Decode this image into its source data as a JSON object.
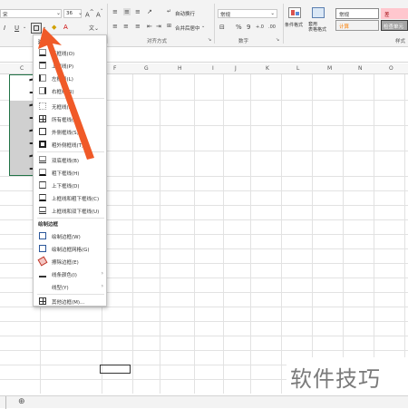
{
  "ribbon": {
    "font_size": "36",
    "font_name_fragment": "宋",
    "wrap_text_label": "自动换行",
    "merge_center_label": "合并后居中",
    "number_format": "常规",
    "align_group_label": "对齐方式",
    "number_group_label": "数字",
    "style_group_label": "样式",
    "conditional_format_label": "条件格式",
    "table_format_label": "套用\n表格格式",
    "style_normal": "常规",
    "style_bad": "差",
    "style_calc": "计算",
    "style_check": "检查单元",
    "percent_symbol": "%",
    "comma_symbol": "9",
    "increase_decimal": "+.0",
    "decrease_decimal": ".00"
  },
  "columns": [
    "C",
    "D",
    "E",
    "F",
    "G",
    "H",
    "I",
    "J",
    "K",
    "L",
    "M",
    "N",
    "O"
  ],
  "cells": [
    "1",
    "1",
    "1",
    "1"
  ],
  "border_menu": {
    "section1_title": "边框",
    "items": [
      {
        "label": "下框线(O)"
      },
      {
        "label": "上框线(P)"
      },
      {
        "label": "左框线(L)"
      },
      {
        "label": "右框线(R)"
      },
      {
        "label": "无框线(N)"
      },
      {
        "label": "所有框线(A)"
      },
      {
        "label": "外侧框线(S)"
      },
      {
        "label": "粗外侧框线(T)"
      },
      {
        "label": "双底框线(B)"
      },
      {
        "label": "粗下框线(H)"
      },
      {
        "label": "上下框线(D)"
      },
      {
        "label": "上框线和粗下框线(C)"
      },
      {
        "label": "上框线和双下框线(U)"
      }
    ],
    "section2_title": "绘制边框",
    "draw_items": [
      {
        "label": "绘制边框(W)"
      },
      {
        "label": "绘制边框网格(G)"
      },
      {
        "label": "擦除边框(E)"
      },
      {
        "label": "线条颜色(I)",
        "submenu": true
      },
      {
        "label": "线型(Y)",
        "submenu": true
      },
      {
        "label": "其他边框(M)..."
      }
    ]
  },
  "watermark_text": "软件技巧",
  "add_sheet_icon": "plus-icon",
  "colors": {
    "accent_green": "#217346",
    "arrow_orange": "#f05a28"
  }
}
